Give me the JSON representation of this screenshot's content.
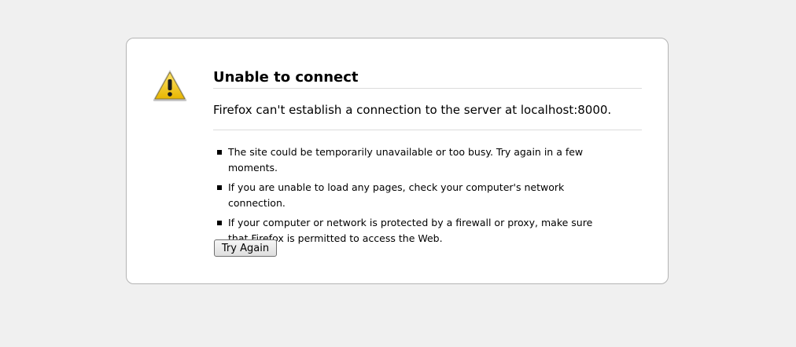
{
  "error": {
    "icon": "warning-triangle-icon",
    "title": "Unable to connect",
    "short_desc": "Firefox can't establish a connection to the server at localhost:8000.",
    "suggestions": [
      "The site could be temporarily unavailable or too busy. Try again in a few moments.",
      "If you are unable to load any pages, check your computer's network connection.",
      "If your computer or network is protected by a firewall or proxy, make sure that Firefox is permitted to access the Web."
    ],
    "button_label": "Try Again"
  },
  "colors": {
    "page_background": "#f0f0f0",
    "box_background": "#ffffff",
    "box_border": "#b4b4b4",
    "icon_fill": "#f5c400"
  }
}
